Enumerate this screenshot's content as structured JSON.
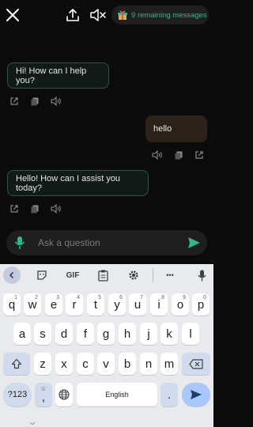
{
  "header": {
    "close_icon": "close-icon",
    "share_icon": "share-icon",
    "mute_icon": "speaker-muted-icon",
    "gift_icon": "gift-icon",
    "remaining_label": "9 remaining messages"
  },
  "messages": [
    {
      "role": "bot",
      "text": "Hi! How can I help you?"
    },
    {
      "role": "user",
      "text": "hello"
    },
    {
      "role": "bot",
      "text": "Hello! How can I assist you today?"
    }
  ],
  "composer": {
    "placeholder": "Ask a question",
    "mic_icon": "microphone-icon",
    "send_icon": "send-icon"
  },
  "keyboard": {
    "toolbar": [
      "chevron-left-icon",
      "sticker-icon",
      "GIF",
      "clipboard-icon",
      "gear-icon",
      "...",
      "microphone-icon"
    ],
    "gif_label": "GIF",
    "more_label": "•••",
    "row1": [
      {
        "k": "q",
        "h": "1"
      },
      {
        "k": "w",
        "h": "2"
      },
      {
        "k": "e",
        "h": "3"
      },
      {
        "k": "r",
        "h": "4"
      },
      {
        "k": "t",
        "h": "5"
      },
      {
        "k": "y",
        "h": "6"
      },
      {
        "k": "u",
        "h": "7"
      },
      {
        "k": "i",
        "h": "8"
      },
      {
        "k": "o",
        "h": "9"
      },
      {
        "k": "p",
        "h": "0"
      }
    ],
    "row2": [
      "a",
      "s",
      "d",
      "f",
      "g",
      "h",
      "j",
      "k",
      "l"
    ],
    "row3": [
      "z",
      "x",
      "c",
      "v",
      "b",
      "n",
      "m"
    ],
    "symbols_label": "?123",
    "emoji_comma_label": ",",
    "space_label": "English",
    "period_label": "."
  },
  "colors": {
    "accent": "#2eb88a",
    "bot_border": "#2e5446",
    "user_bubble": "#2b2219",
    "keyboard_bg": "#e8eaed",
    "enter_key": "#a8c7fa"
  }
}
